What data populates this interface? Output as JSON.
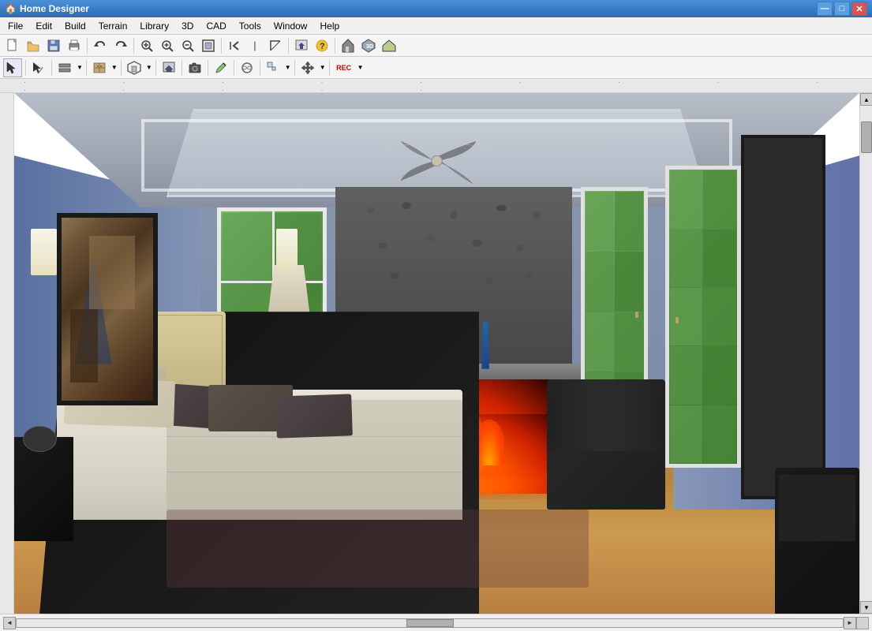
{
  "window": {
    "title": "Home Designer",
    "icon": "🏠"
  },
  "titlebar": {
    "title": "Home Designer",
    "controls": {
      "minimize": "—",
      "maximize": "□",
      "close": "✕"
    }
  },
  "menubar": {
    "items": [
      {
        "id": "file",
        "label": "File"
      },
      {
        "id": "edit",
        "label": "Edit"
      },
      {
        "id": "build",
        "label": "Build"
      },
      {
        "id": "terrain",
        "label": "Terrain"
      },
      {
        "id": "library",
        "label": "Library"
      },
      {
        "id": "3d",
        "label": "3D"
      },
      {
        "id": "cad",
        "label": "CAD"
      },
      {
        "id": "tools",
        "label": "Tools"
      },
      {
        "id": "window",
        "label": "Window"
      },
      {
        "id": "help",
        "label": "Help"
      }
    ]
  },
  "toolbar1": {
    "buttons": [
      {
        "id": "new",
        "icon": "📄",
        "label": "New"
      },
      {
        "id": "open",
        "icon": "📂",
        "label": "Open"
      },
      {
        "id": "save",
        "icon": "💾",
        "label": "Save"
      },
      {
        "id": "print",
        "icon": "🖨",
        "label": "Print"
      },
      {
        "id": "undo",
        "icon": "↩",
        "label": "Undo"
      },
      {
        "id": "redo",
        "icon": "↪",
        "label": "Redo"
      },
      {
        "id": "zoom-in-box",
        "icon": "🔍",
        "label": "Zoom In Box"
      },
      {
        "id": "zoom-in",
        "icon": "+🔍",
        "label": "Zoom In"
      },
      {
        "id": "zoom-out",
        "icon": "-🔍",
        "label": "Zoom Out"
      },
      {
        "id": "fill-window",
        "icon": "⛶",
        "label": "Fill Window"
      },
      {
        "id": "undo2",
        "icon": "⇦",
        "label": "Undo"
      }
    ]
  },
  "toolbar2": {
    "buttons": [
      {
        "id": "select",
        "icon": "↖",
        "label": "Select Objects"
      },
      {
        "id": "arc",
        "icon": "⌒",
        "label": "Arc"
      },
      {
        "id": "wall",
        "icon": "⊟",
        "label": "Wall"
      },
      {
        "id": "cabinet",
        "icon": "▦",
        "label": "Cabinet"
      },
      {
        "id": "interior",
        "icon": "⌂",
        "label": "Interior"
      },
      {
        "id": "export",
        "icon": "⇨",
        "label": "Export"
      },
      {
        "id": "camera",
        "icon": "📷",
        "label": "Camera"
      },
      {
        "id": "paint",
        "icon": "🎨",
        "label": "Paint"
      },
      {
        "id": "material",
        "icon": "◈",
        "label": "Material"
      },
      {
        "id": "stairs",
        "icon": "⊞",
        "label": "Stairs"
      },
      {
        "id": "move",
        "icon": "✥",
        "label": "Move"
      },
      {
        "id": "rec",
        "icon": "REC",
        "label": "Record"
      }
    ]
  },
  "statusbar": {
    "left_text": ""
  },
  "scene": {
    "type": "3d_render",
    "description": "Master bedroom 3D view with fireplace, bed, and french doors"
  }
}
